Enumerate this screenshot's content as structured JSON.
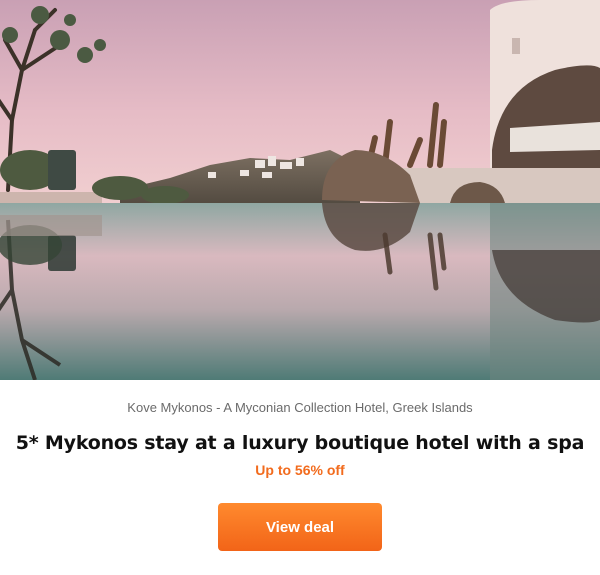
{
  "hero": {
    "image_desc": "infinity pool at dusk with whitewashed Mykonos hillside and daybed terrace"
  },
  "offer": {
    "hotel_name": "Kove Mykonos - A Myconian Collection Hotel, Greek Islands",
    "headline": "5* Mykonos stay at a luxury boutique hotel with a spa",
    "discount": "Up to 56% off"
  },
  "cta": {
    "label": "View deal"
  },
  "colors": {
    "accent": "#f26b1d",
    "button_top": "#ff8a2e",
    "button_bottom": "#f26418",
    "headline": "#111111",
    "subtle_text": "#6b6b6b"
  }
}
